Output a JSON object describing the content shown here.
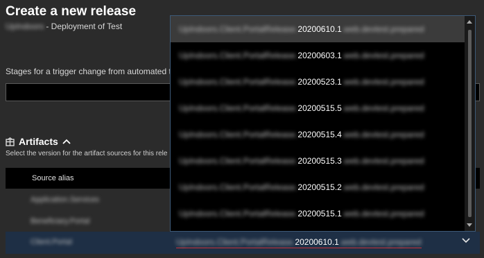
{
  "panel": {
    "title": "Create a new release",
    "project_name": "UpIndoors",
    "subtitle_suffix": "- Deployment of Test"
  },
  "stages": {
    "label": "Stages for a trigger change from automated t",
    "value": ""
  },
  "artifacts": {
    "heading": "Artifacts",
    "description": "Select the version for the artifact sources for this rele",
    "column_header": "Source alias",
    "rows": [
      {
        "alias": "Application.Services"
      },
      {
        "alias": "Beneficiary.Portal"
      }
    ],
    "selected_row": {
      "alias": "Client.Portal",
      "value_prefix": "UpIndoors.Client.PortalRelease.",
      "value_version": "20200610.1",
      "value_suffix": ".web.devtest.prepared"
    }
  },
  "dropdown": {
    "options": [
      {
        "prefix": "UpIndoors.Client.PortalRelease.",
        "version": "20200610.1",
        "suffix": ".web.devtest.prepared"
      },
      {
        "prefix": "UpIndoors.Client.PortalRelease.",
        "version": "20200603.1",
        "suffix": ".web.devtest.prepared"
      },
      {
        "prefix": "UpIndoors.Client.PortalRelease.",
        "version": "20200523.1",
        "suffix": ".web.devtest.prepared"
      },
      {
        "prefix": "UpIndoors.Client.PortalRelease.",
        "version": "20200515.5",
        "suffix": ".web.devtest.prepared"
      },
      {
        "prefix": "UpIndoors.Client.PortalRelease.",
        "version": "20200515.4",
        "suffix": ".web.devtest.prepared"
      },
      {
        "prefix": "UpIndoors.Client.PortalRelease.",
        "version": "20200515.3",
        "suffix": ".web.devtest.prepared"
      },
      {
        "prefix": "UpIndoors.Client.PortalRelease.",
        "version": "20200515.2",
        "suffix": ".web.devtest.prepared"
      },
      {
        "prefix": "UpIndoors.Client.PortalRelease.",
        "version": "20200515.1",
        "suffix": ".web.devtest.prepared"
      }
    ]
  },
  "icons": {
    "artifacts": "package-icon",
    "collapse": "chevron-up-icon",
    "expand": "chevron-down-icon"
  }
}
